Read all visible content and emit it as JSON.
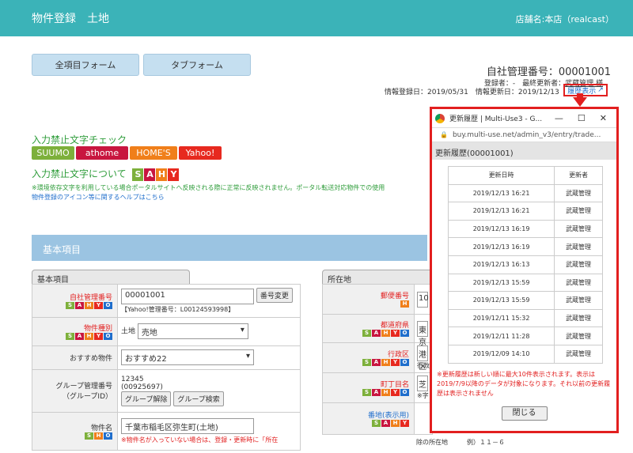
{
  "header": {
    "title": "物件登録　土地",
    "store": "店舗名:本店（realcast）"
  },
  "tabs": {
    "full": "全項目フォーム",
    "tab": "タブフォーム"
  },
  "mgmt": {
    "number": "自社管理番号：00001001",
    "registrant_label": "登録者：-　最終更新者：",
    "updater": "武蔵管理 様",
    "reg_date": "情報登録日：2019/05/31　情報更新日：2019/12/13",
    "history_link": "履歴表示"
  },
  "ng": {
    "title": "入力禁止文字チェック",
    "portals": [
      "SUUMO",
      "athome",
      "HOME'S",
      "Yahoo!"
    ],
    "about": "入力禁止文字について",
    "sahy": [
      "S",
      "A",
      "H",
      "Y"
    ],
    "note": "※環境依存文字を利用している場合ポータルサイトへ反映される際に正常に反映されません。ポータル転送対応物件での使用",
    "help": "物件登録のアイコン等に関するヘルプはこちら"
  },
  "section": {
    "title": "基本項目",
    "subtab_left": "基本項目",
    "subtab_right": "所在地"
  },
  "form": {
    "mgmt_label": "自社管理番号",
    "mgmt_value": "00001001",
    "mgmt_btn": "番号変更",
    "yahoo_no": "【Yahoo!管理番号：L00124593998】",
    "type_label": "物件種別",
    "type_prefix": "土地",
    "type_value": "売地",
    "rec_label": "おすすめ物件",
    "rec_value": "おすすめ22",
    "group_label": "グループ管理番号",
    "group_sub": "（グループID）",
    "group_no": "12345",
    "group_id": "(00925697)",
    "group_unlink": "グループ解除",
    "group_search": "グループ検索",
    "name_label": "物件名",
    "name_value": "千葉市稲毛区弥生町(土地)",
    "name_note": "※物件名が入っていない場合は、登録・更新時に「所在"
  },
  "address": {
    "zip_label": "郵便番号",
    "zip_value": "10",
    "pref_label": "都道府県",
    "pref_value": "東京",
    "city_label": "行政区",
    "city_value": "港区",
    "city_sub": "行政",
    "town_label": "町丁目名",
    "town_value": "芝",
    "town_note": "※字",
    "lot_label": "番地(表示用)",
    "lot_value": "",
    "lot_note": "除の所在地　　　例）１１－６"
  },
  "popup": {
    "title": "更新履歴 | Multi-Use3 - G...",
    "url": "buy.multi-use.net/admin_v3/entry/trade...",
    "heading": "更新履歴(00001001)",
    "col_date": "更新日時",
    "col_user": "更新者",
    "rows": [
      [
        "2019/12/13 16:21",
        "武蔵管理"
      ],
      [
        "2019/12/13 16:21",
        "武蔵管理"
      ],
      [
        "2019/12/13 16:19",
        "武蔵管理"
      ],
      [
        "2019/12/13 16:19",
        "武蔵管理"
      ],
      [
        "2019/12/13 16:13",
        "武蔵管理"
      ],
      [
        "2019/12/13 15:59",
        "武蔵管理"
      ],
      [
        "2019/12/13 15:59",
        "武蔵管理"
      ],
      [
        "2019/12/11 15:32",
        "武蔵管理"
      ],
      [
        "2019/12/11 11:28",
        "武蔵管理"
      ],
      [
        "2019/12/09 14:10",
        "武蔵管理"
      ]
    ],
    "note": "※更新履歴は新しい順に最大10件表示されます。表示は2019/7/9以降のデータが対象になります。それ以前の更新履歴は表示されません",
    "close": "閉じる"
  },
  "colors": {
    "header": "#3bb3b8",
    "accent_red": "#e21f1f",
    "section": "#9bc4e2"
  }
}
